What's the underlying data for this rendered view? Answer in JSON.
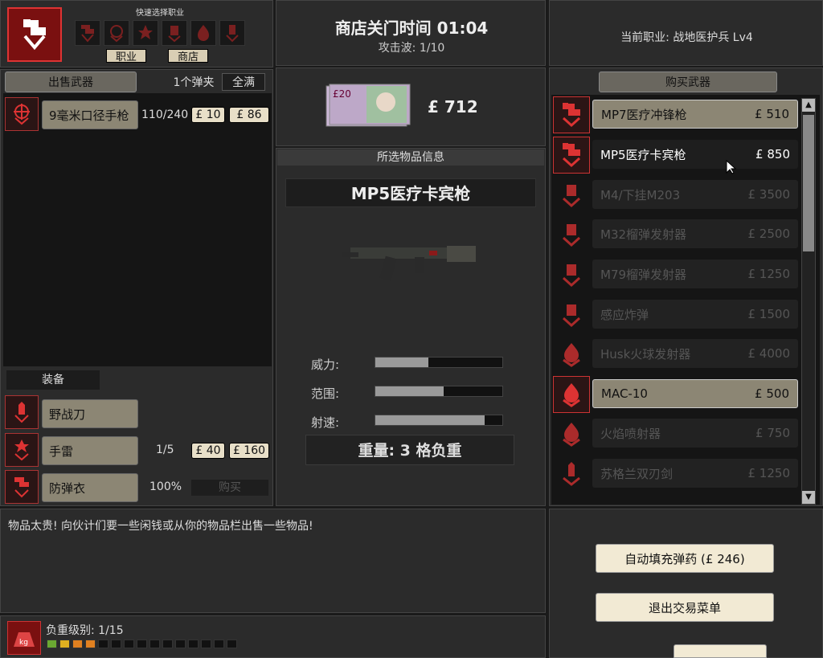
{
  "colors": {
    "accent_red": "#d33333",
    "panel": "#2b2b2b",
    "tag_bg": "#d9ceb4",
    "selected_bg": "#8c8674"
  },
  "quick": {
    "title": "快速选择职业",
    "slots": [
      "medic-icon",
      "commando-icon",
      "support-icon",
      "sharpshooter-icon",
      "firebug-icon",
      "demolition-icon"
    ]
  },
  "tags": {
    "class_label": "职业",
    "shop_label": "商店"
  },
  "header": {
    "title": "商店关门时间 01:04",
    "wave": "攻击波: 1/10",
    "current_class": "当前职业: 战地医护兵 Lv4"
  },
  "money": {
    "amount": "£ 712"
  },
  "sell": {
    "title": "出售武器",
    "clip_label": "1个弹夹",
    "fill_label": "全满",
    "weapons": [
      {
        "name": "9毫米口径手枪",
        "ammo": "110/240",
        "clip_price": "£ 10",
        "fill_price": "£ 86"
      }
    ]
  },
  "equip": {
    "title": "装备",
    "items": [
      {
        "name": "野战刀"
      },
      {
        "name": "手雷",
        "count": "1/5",
        "price1": "£ 40",
        "price2": "£ 160"
      },
      {
        "name": "防弹衣",
        "count": "100%",
        "buy": "购买"
      }
    ]
  },
  "info": {
    "title": "所选物品信息",
    "item_name": "MP5医疗卡宾枪",
    "stats": [
      {
        "label": "威力:",
        "value": 0.42
      },
      {
        "label": "范围:",
        "value": 0.54
      },
      {
        "label": "射速:",
        "value": 0.86
      }
    ],
    "weight": "重量: 3 格负重"
  },
  "buy": {
    "title": "购买武器",
    "items": [
      {
        "name": "MP7医疗冲锋枪",
        "price": "£ 510",
        "state": "sel"
      },
      {
        "name": "MP5医疗卡宾枪",
        "price": "£ 850",
        "state": "ok"
      },
      {
        "name": "M4/下挂M203",
        "price": "£ 3500",
        "state": "dis"
      },
      {
        "name": "M32榴弹发射器",
        "price": "£ 2500",
        "state": "dis"
      },
      {
        "name": "M79榴弹发射器",
        "price": "£ 1250",
        "state": "dis"
      },
      {
        "name": "感应炸弹",
        "price": "£ 1500",
        "state": "dis"
      },
      {
        "name": "Husk火球发射器",
        "price": "£ 4000",
        "state": "dis"
      },
      {
        "name": "MAC-10",
        "price": "£ 500",
        "state": "sel"
      },
      {
        "name": "火焰喷射器",
        "price": "£ 750",
        "state": "dis"
      },
      {
        "name": "苏格兰双刃剑",
        "price": "£ 1250",
        "state": "dis"
      }
    ]
  },
  "message": "物品太贵! 向伙计们要一些闲钱或从你的物品栏出售一些物品!",
  "weight_level": {
    "label": "负重级别: 1/15",
    "filled": 4,
    "total": 15,
    "icon_text": "kg"
  },
  "actions": {
    "autofill": "自动填充弹药 (£ 246)",
    "exit": "退出交易菜单"
  }
}
